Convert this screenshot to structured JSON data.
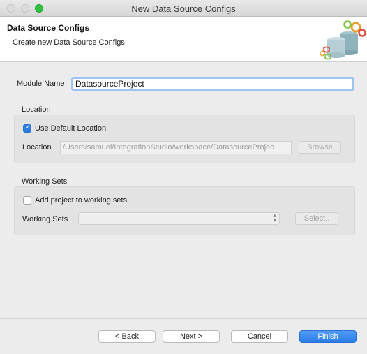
{
  "window": {
    "title": "New Data Source Configs"
  },
  "header": {
    "title": "Data Source Configs",
    "subtitle": "Create new Data Source Configs"
  },
  "module": {
    "label": "Module Name",
    "value": "DatasourceProject"
  },
  "location": {
    "section_title": "Location",
    "use_default_label": "Use Default Location",
    "use_default_checked": true,
    "path_label": "Location",
    "path_value": "/Users/samuel/IntegrationStudio/workspace/DatasourceProjec",
    "browse_label": "Browse"
  },
  "working_sets": {
    "section_title": "Working Sets",
    "add_label": "Add project to working sets",
    "add_checked": false,
    "sets_label": "Working Sets",
    "selected_value": "",
    "select_label": "Select.."
  },
  "footer": {
    "back_label": "< Back",
    "next_label": "Next >",
    "cancel_label": "Cancel",
    "finish_label": "Finish"
  },
  "colors": {
    "accent": "#2f7de1",
    "finish_button": "#2a7ce8",
    "focus_ring": "#9dc3f3",
    "maximize": "#2fc241"
  },
  "icons": {
    "wizard_banner": "database-gears-icon",
    "checkbox_on": "check-icon",
    "dropdown": "up-down-chevron-icon"
  }
}
